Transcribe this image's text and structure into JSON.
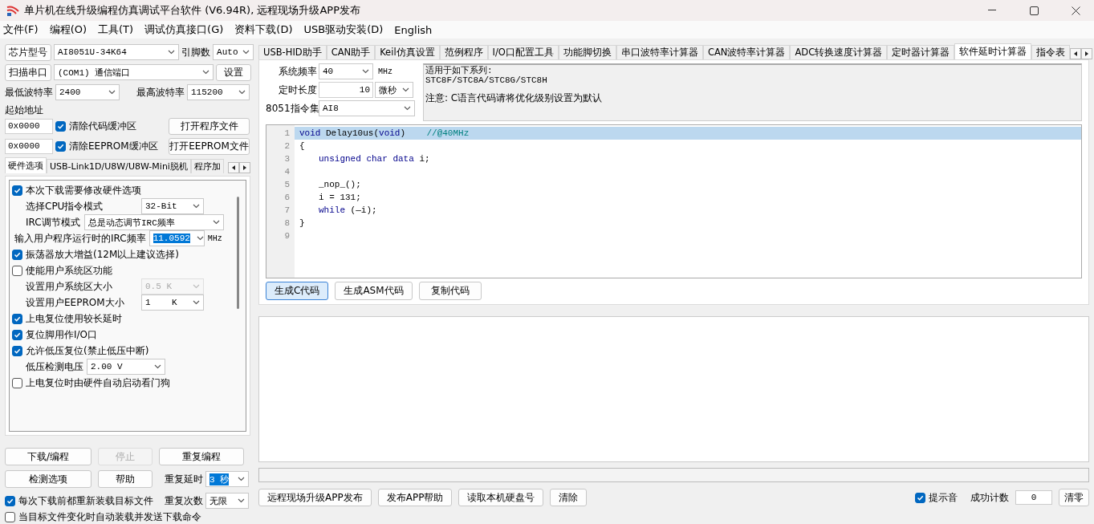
{
  "window": {
    "title": "单片机在线升级编程仿真调试平台软件 (V6.94R), 远程现场升级APP发布"
  },
  "menu": [
    "文件(F)",
    "编程(O)",
    "工具(T)",
    "调试仿真接口(G)",
    "资料下载(D)",
    "USB驱动安装(D)",
    "English"
  ],
  "left": {
    "chip": {
      "button": "芯片型号",
      "value": "AI8051U-34K64"
    },
    "pins": {
      "label": "引脚数",
      "value": "Auto"
    },
    "port": {
      "button": "扫描串口",
      "value": "(COM1) 通信端口",
      "settings": "设置"
    },
    "baud_min": {
      "label": "最低波特率",
      "value": "2400"
    },
    "baud_max": {
      "label": "最高波特率",
      "value": "115200"
    },
    "start_address_label": "起始地址",
    "file_rows": [
      {
        "address": "0x0000",
        "label": "清除代码缓冲区",
        "checked": true,
        "button": "打开程序文件"
      },
      {
        "address": "0x0000",
        "label": "清除EEPROM缓冲区",
        "checked": true,
        "button": "打开EEPROM文件"
      }
    ],
    "tabs": [
      {
        "label": "硬件选项",
        "selected": true
      },
      {
        "label": "USB-Link1D/U8W/U8W-Mini脱机",
        "selected": false
      },
      {
        "label": "程序加",
        "selected": false
      }
    ],
    "options": [
      {
        "kind": "checkbox",
        "label": "本次下载需要修改硬件选项",
        "checked": true
      },
      {
        "kind": "select",
        "label": "选择CPU指令模式",
        "value": "32-Bit",
        "disabled": false
      },
      {
        "kind": "select",
        "label": "IRC调节模式",
        "value": "总是动态调节IRC频率",
        "disabled": false
      },
      {
        "kind": "frequency",
        "label": "输入用户程序运行时的IRC频率",
        "value": "11.0592",
        "selected": true,
        "unit": "MHz"
      },
      {
        "kind": "checkbox",
        "label": "振荡器放大增益(12M以上建议选择)",
        "checked": true
      },
      {
        "kind": "checkbox",
        "label": "使能用户系统区功能",
        "checked": false
      },
      {
        "kind": "select",
        "label": "设置用户系统区大小",
        "value": "0.5 K",
        "disabled": true
      },
      {
        "kind": "select",
        "label": "设置用户EEPROM大小",
        "value": "1    K",
        "disabled": false
      },
      {
        "kind": "checkbox",
        "label": "上电复位使用较长延时",
        "checked": true
      },
      {
        "kind": "checkbox",
        "label": "复位脚用作I/O口",
        "checked": true
      },
      {
        "kind": "checkbox",
        "label": "允许低压复位(禁止低压中断)",
        "checked": true
      },
      {
        "kind": "select",
        "label": "低压检测电压",
        "value": "2.00 V",
        "disabled": false
      },
      {
        "kind": "checkbox",
        "label": "上电复位时由硬件自动启动看门狗",
        "checked": false
      }
    ],
    "buttons": [
      {
        "label": "下载/编程",
        "disabled": false
      },
      {
        "label": "停止",
        "disabled": true
      },
      {
        "label": "重复编程",
        "disabled": false
      },
      {
        "label": "检测选项",
        "disabled": false
      },
      {
        "label": "帮助",
        "disabled": false
      }
    ],
    "repeat_delay": {
      "label": "重复延时",
      "value": "3 秒",
      "selected": true
    },
    "repeat_count": {
      "label": "重复次数",
      "value": "无限",
      "selected": false
    },
    "auto_options": [
      {
        "label": "每次下载前都重新装载目标文件",
        "checked": true
      },
      {
        "label": "当目标文件变化时自动装载并发送下载命令",
        "checked": false
      }
    ]
  },
  "right": {
    "tabs": [
      {
        "label": "USB-HID助手",
        "selected": false
      },
      {
        "label": "CAN助手",
        "selected": false
      },
      {
        "label": "Keil仿真设置",
        "selected": false
      },
      {
        "label": "范例程序",
        "selected": false
      },
      {
        "label": "I/O口配置工具",
        "selected": false
      },
      {
        "label": "功能脚切换",
        "selected": false
      },
      {
        "label": "串口波特率计算器",
        "selected": false
      },
      {
        "label": "CAN波特率计算器",
        "selected": false
      },
      {
        "label": "ADC转换速度计算器",
        "selected": false
      },
      {
        "label": "定时器计算器",
        "selected": false
      },
      {
        "label": "软件延时计算器",
        "selected": true
      },
      {
        "label": "指令表",
        "selected": false
      }
    ],
    "frequency": {
      "label": "系统频率",
      "value": "40",
      "unit": "MHz"
    },
    "duration": {
      "label": "定时长度",
      "value": "10",
      "unit": "微秒"
    },
    "instruction_set": {
      "label": "8051指令集",
      "value": "AI8"
    },
    "info": [
      "适用于如下系列:",
      "STC8F/STC8A/STC8G/STC8H",
      "注意: C语言代码请将优化级别设置为默认"
    ],
    "code": [
      {
        "number": "1",
        "selected": true,
        "segments": [
          {
            "kind": "keyword",
            "text": "void"
          },
          {
            "kind": "plain",
            "text": " Delay10us("
          },
          {
            "kind": "keyword",
            "text": "void"
          },
          {
            "kind": "plain",
            "text": ")    "
          },
          {
            "kind": "comment",
            "text": "//@40MHz"
          }
        ]
      },
      {
        "number": "2",
        "selected": false,
        "segments": [
          {
            "kind": "plain",
            "text": "{"
          }
        ]
      },
      {
        "number": "3",
        "selected": false,
        "indented": true,
        "segments": [
          {
            "kind": "keyword",
            "text": "unsigned char data"
          },
          {
            "kind": "plain",
            "text": " i;"
          }
        ]
      },
      {
        "number": "4",
        "selected": false
      },
      {
        "number": "5",
        "selected": false,
        "indented": true,
        "segments": [
          {
            "kind": "plain",
            "text": "_nop_();"
          }
        ]
      },
      {
        "number": "6",
        "selected": false,
        "indented": true,
        "segments": [
          {
            "kind": "plain",
            "text": "i = 131;"
          }
        ]
      },
      {
        "number": "7",
        "selected": false,
        "indented": true,
        "segments": [
          {
            "kind": "keyword",
            "text": "while"
          },
          {
            "kind": "plain",
            "text": " (—i);"
          }
        ]
      },
      {
        "number": "8",
        "selected": false,
        "segments": [
          {
            "kind": "plain",
            "text": "}"
          }
        ]
      },
      {
        "number": "9",
        "selected": false
      }
    ],
    "code_buttons": [
      {
        "label": "生成C代码",
        "selected": true
      },
      {
        "label": "生成ASM代码",
        "selected": false
      },
      {
        "label": "复制代码",
        "selected": false
      }
    ],
    "bottom_buttons": [
      "远程现场升级APP发布",
      "发布APP帮助",
      "读取本机硬盘号",
      "清除"
    ],
    "sound": {
      "label": "提示音",
      "checked": true
    },
    "success_count": {
      "label": "成功计数",
      "value": "0",
      "reset": "清零"
    }
  }
}
